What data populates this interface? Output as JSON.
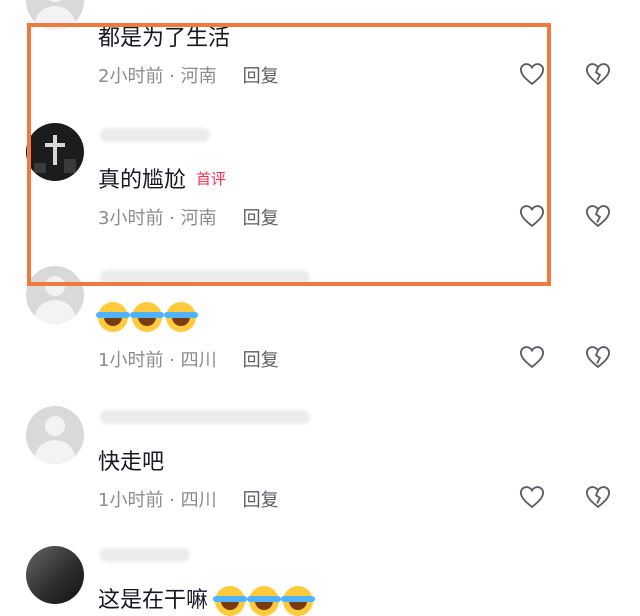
{
  "comments": [
    {
      "content": "都是为了生活",
      "time": "2小时前 · 河南",
      "reply": "回复",
      "badge": ""
    },
    {
      "content": "真的尴尬",
      "time": "3小时前 · 河南",
      "reply": "回复",
      "badge": "首评"
    },
    {
      "content": "",
      "time": "1小时前 · 四川",
      "reply": "回复",
      "badge": ""
    },
    {
      "content": "快走吧",
      "time": "1小时前 · 四川",
      "reply": "回复",
      "badge": ""
    },
    {
      "content": "这是在干嘛",
      "time": "",
      "reply": "",
      "badge": ""
    }
  ],
  "icons": {
    "like": "heart-icon",
    "dislike": "broken-heart-icon"
  },
  "colors": {
    "highlight": "#f07a3e",
    "badge": "#fe2c55",
    "meta": "#8a8b91"
  }
}
